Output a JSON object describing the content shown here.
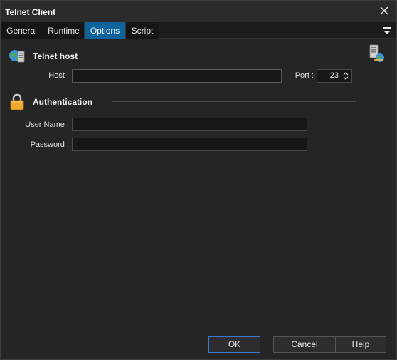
{
  "window": {
    "title": "Telnet Client"
  },
  "tabs": [
    {
      "label": "General",
      "active": false
    },
    {
      "label": "Runtime",
      "active": false
    },
    {
      "label": "Options",
      "active": true
    },
    {
      "label": "Script",
      "active": false
    }
  ],
  "telnet_host": {
    "title": "Telnet host",
    "host_label": "Host :",
    "host_value": "",
    "port_label": "Port :",
    "port_value": "23"
  },
  "authentication": {
    "title": "Authentication",
    "username_label": "User Name :",
    "username_value": "",
    "password_label": "Password :",
    "password_value": ""
  },
  "buttons": {
    "ok": "OK",
    "cancel": "Cancel",
    "help": "Help"
  },
  "colors": {
    "accent": "#0e639c",
    "background": "#252526",
    "field": "#171717"
  },
  "icons": [
    "close-icon",
    "tab-menu-icon",
    "telnet-host-icon",
    "lock-icon",
    "telnet-client-icon"
  ]
}
